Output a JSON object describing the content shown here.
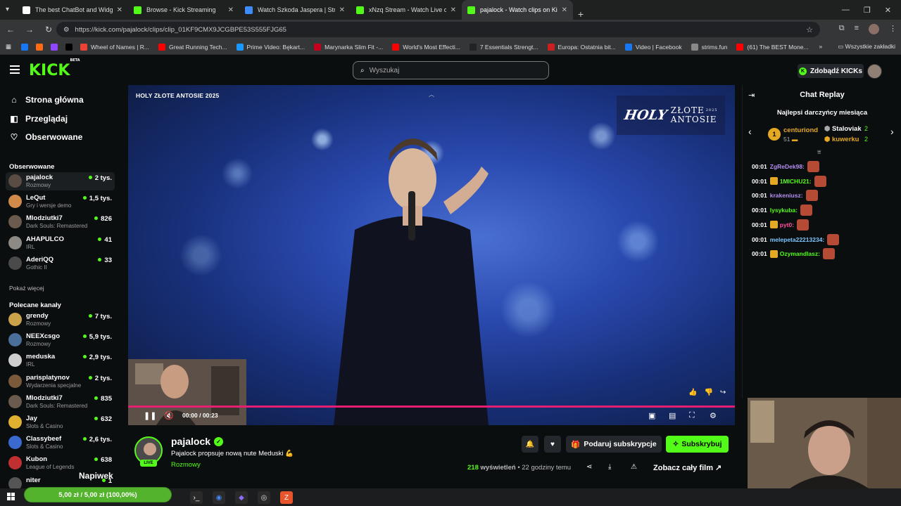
{
  "browser": {
    "tabs": [
      {
        "title": "The best ChatBot and Widgets",
        "color": "#ffffff"
      },
      {
        "title": "Browse - Kick Streaming",
        "color": "#53fc18"
      },
      {
        "title": "Watch Szkoda Jaspera | Stream",
        "color": "#3d8bfd"
      },
      {
        "title": "xNzq Stream - Watch Live on K",
        "color": "#53fc18"
      },
      {
        "title": "pajalock - Watch clips on Kick",
        "color": "#53fc18"
      }
    ],
    "url": "https://kick.com/pajalock/clips/clip_01KF9CMX9JCGBPE53S555FJG65",
    "bookmarks": [
      {
        "label": "",
        "color": "#1877f2"
      },
      {
        "label": "",
        "color": "#ff6a13"
      },
      {
        "label": "",
        "color": "#9146ff"
      },
      {
        "label": "",
        "color": "#000000"
      },
      {
        "label": "Wheel of Names | R...",
        "color": "#ea4335"
      },
      {
        "label": "Great Running Tech...",
        "color": "#ff0000"
      },
      {
        "label": "Prime Video: Bękart...",
        "color": "#1a98ff"
      },
      {
        "label": "Marynarka Slim Fit -...",
        "color": "#c4001a"
      },
      {
        "label": "World's Most Effecti...",
        "color": "#ff0000"
      },
      {
        "label": "7 Essentials Strengt...",
        "color": "#222222"
      },
      {
        "label": "Europa: Ostatnia bit...",
        "color": "#cc2020"
      },
      {
        "label": "Video | Facebook",
        "color": "#1877f2"
      },
      {
        "label": "strims.fun",
        "color": "#888888"
      },
      {
        "label": "(61) The BEST Mone...",
        "color": "#ff0000"
      }
    ],
    "all_bookmarks": "Wszystkie zakładki"
  },
  "header": {
    "logo": "KICK",
    "logo_sup": "BETA",
    "search_placeholder": "Wyszukaj",
    "get_kicks": "Zdobądź KICKs"
  },
  "sidebar": {
    "nav": [
      {
        "label": "Strona główna",
        "icon": "home-icon"
      },
      {
        "label": "Przeglądaj",
        "icon": "browse-icon"
      },
      {
        "label": "Obserwowane",
        "icon": "heart-icon"
      }
    ],
    "following_title": "Obserwowane",
    "following": [
      {
        "name": "pajalock",
        "category": "Rozmowy",
        "viewers": "2 tys.",
        "color": "#5a4b44"
      },
      {
        "name": "LeQut",
        "category": "Gry i wersje demo",
        "viewers": "1,5 tys.",
        "color": "#d08b4a"
      },
      {
        "name": "Mlodziutki7",
        "category": "Dark Souls: Remastered",
        "viewers": "826",
        "color": "#6b5a4e"
      },
      {
        "name": "AHAPULCO",
        "category": "IRL",
        "viewers": "41",
        "color": "#8d8a85"
      },
      {
        "name": "AderiQQ",
        "category": "Gothic II",
        "viewers": "33",
        "color": "#4a4a4a"
      }
    ],
    "show_more": "Pokaż więcej",
    "recommended_title": "Polecane kanały",
    "recommended": [
      {
        "name": "grendy",
        "category": "Rozmowy",
        "viewers": "7 tys.",
        "color": "#c9a24a"
      },
      {
        "name": "NEEXcsgo",
        "category": "Rozmowy",
        "viewers": "5,9 tys.",
        "color": "#4a6f9a"
      },
      {
        "name": "meduska",
        "category": "IRL",
        "viewers": "2,9 tys.",
        "color": "#cfcfcf"
      },
      {
        "name": "parisplatynov",
        "category": "Wydarzenia specjalne",
        "viewers": "2 tys.",
        "color": "#7a5a3a"
      },
      {
        "name": "Mlodziutki7",
        "category": "Dark Souls: Remastered",
        "viewers": "835",
        "color": "#6b5a4e"
      },
      {
        "name": "Jay",
        "category": "Slots & Casino",
        "viewers": "632",
        "color": "#e0b030"
      },
      {
        "name": "Classybeef",
        "category": "Slots & Casino",
        "viewers": "2,6 tys.",
        "color": "#3a6ad0"
      },
      {
        "name": "Kubon",
        "category": "League of Legends",
        "viewers": "638",
        "color": "#c03030"
      },
      {
        "name": "niter",
        "category": "",
        "viewers": "1",
        "color": "#555555"
      }
    ],
    "tip_label": "Napiwek"
  },
  "video": {
    "title": "HOLY ZŁOTE ANTOSIE 2025",
    "overlay_brand": "HOLY",
    "overlay_text_1": "ZŁOTE",
    "overlay_text_2": "ANTOSIE",
    "overlay_year": "2025",
    "current_time": "00:00",
    "duration": "00:23",
    "progress_fraction": 1.0
  },
  "clip": {
    "channel": "pajalock",
    "live_badge": "LIVE",
    "title": "Pajalock propsuje nową nute Meduski 💪",
    "category": "Rozmowy",
    "gift_sub": "Podaruj subskrypcje",
    "subscribe": "Subskrybuj",
    "views_count": "218",
    "views_label": "wyświetleń",
    "age": "• 22 godziny temu",
    "watch_full": "Zobacz cały film"
  },
  "chat": {
    "title": "Chat Replay",
    "donors_title": "Najlepsi darczyńcy miesiąca",
    "donor_rank": "1",
    "donors": [
      {
        "name": "centuriond",
        "amount": "51",
        "color": "#e5a823"
      },
      {
        "name": "Staloviak",
        "amount": "2",
        "color": "#ffffff"
      },
      {
        "name": "kuwerku",
        "amount": "2",
        "color": "#e5a823"
      }
    ],
    "messages": [
      {
        "time": "00:01",
        "user": "ZgReDek98:",
        "color": "#b48ef0",
        "badge": false
      },
      {
        "time": "00:01",
        "user": "1MICHU21:",
        "color": "#53fc18",
        "badge": true
      },
      {
        "time": "00:01",
        "user": "krakeniusz:",
        "color": "#b48ef0",
        "badge": false
      },
      {
        "time": "00:01",
        "user": "lysykuba:",
        "color": "#53fc18",
        "badge": false
      },
      {
        "time": "00:01",
        "user": "pyt0:",
        "color": "#ff4e9b",
        "badge": true
      },
      {
        "time": "00:01",
        "user": "melepeta22213234:",
        "color": "#7ec8ff",
        "badge": false
      },
      {
        "time": "00:01",
        "user": "Ozymandlasz:",
        "color": "#53fc18",
        "badge": true
      }
    ]
  },
  "taskbar": {
    "tip_progress": "5,00 zł / 5,00 zł (100,00%)",
    "tip_fraction": 1.0
  }
}
